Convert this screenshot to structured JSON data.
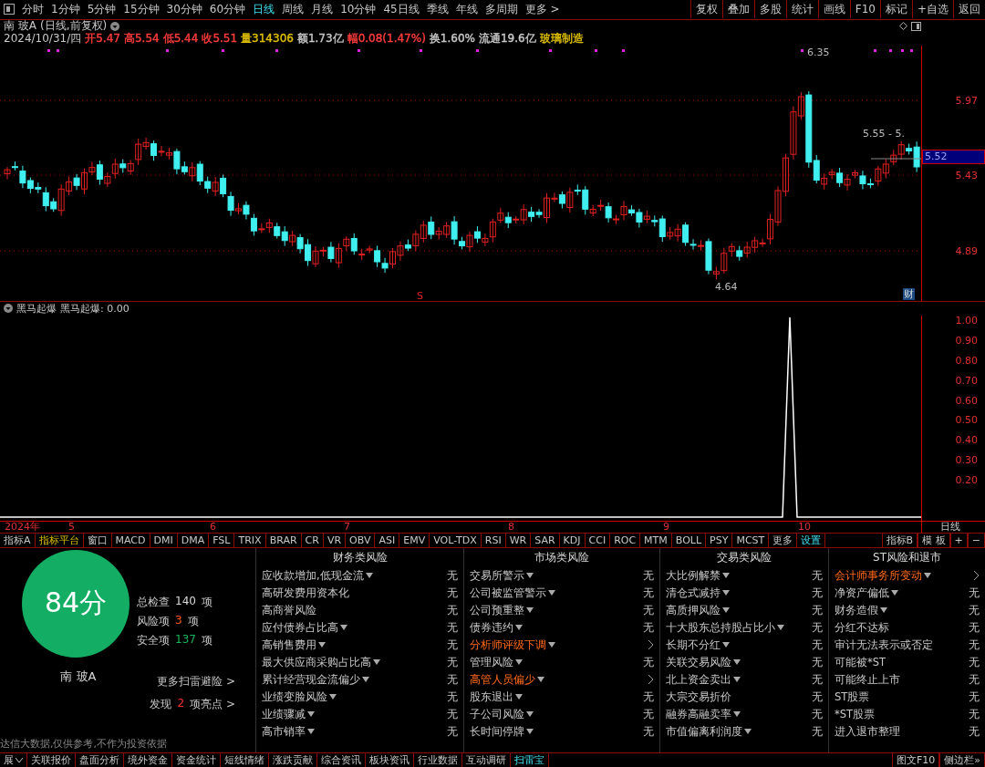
{
  "period_tabs": [
    {
      "label": "分时",
      "selected": false
    },
    {
      "label": "1分钟",
      "selected": false
    },
    {
      "label": "5分钟",
      "selected": false
    },
    {
      "label": "15分钟",
      "selected": false
    },
    {
      "label": "30分钟",
      "selected": false
    },
    {
      "label": "60分钟",
      "selected": false
    },
    {
      "label": "日线",
      "selected": true
    },
    {
      "label": "周线",
      "selected": false
    },
    {
      "label": "月线",
      "selected": false
    },
    {
      "label": "10分钟",
      "selected": false
    },
    {
      "label": "45日线",
      "selected": false
    },
    {
      "label": "季线",
      "selected": false
    },
    {
      "label": "年线",
      "selected": false
    },
    {
      "label": "多周期",
      "selected": false
    },
    {
      "label": "更多 >",
      "selected": false
    }
  ],
  "toolbar_buttons": [
    "复权",
    "叠加",
    "多股",
    "统计",
    "画线",
    "F10",
    "标记",
    "+自选",
    "返回"
  ],
  "stock": {
    "name": "南 玻A",
    "mode": "(日线,前复权)"
  },
  "quote": {
    "date": "2024/10/31/四",
    "items": [
      {
        "text": "开5.47",
        "color": "#ff3c3c"
      },
      {
        "text": "高5.54",
        "color": "#ff3c3c"
      },
      {
        "text": "低5.44",
        "color": "#ff3c3c"
      },
      {
        "text": "收5.51",
        "color": "#ff3c3c"
      },
      {
        "text": "量314306",
        "color": "#e0c000"
      },
      {
        "text": "额1.73亿",
        "color": "#c8c8c8"
      },
      {
        "text": "幅0.08(1.47%)",
        "color": "#ff3c3c"
      },
      {
        "text": "换1.60%",
        "color": "#c8c8c8"
      },
      {
        "text": "流通19.6亿",
        "color": "#c8c8c8"
      },
      {
        "text": "玻璃制造",
        "color": "#e0c000"
      }
    ]
  },
  "main_chart": {
    "high_label": "6.35",
    "low_label": "4.64",
    "last_label": "5.55 - 5.",
    "signal_mark": "S",
    "finance_mark": "财",
    "axis_labels": [
      "5.97",
      "5.43",
      "4.89"
    ],
    "current_price": "5.52"
  },
  "indicator": {
    "name": "黑马起爆",
    "reading": "黑马起爆: 0.00",
    "axis_labels": [
      "1.00",
      "0.90",
      "0.80",
      "0.70",
      "0.60",
      "0.50",
      "0.40",
      "0.30",
      "0.20"
    ]
  },
  "date_axis": {
    "labels": [
      "2024年",
      "5",
      "6",
      "7",
      "8",
      "9",
      "10"
    ],
    "period": "日线"
  },
  "indicator_tabs": [
    {
      "label": "指标A",
      "kind": "tab",
      "selected": false
    },
    {
      "label": "指标平台",
      "kind": "tab",
      "selected": true
    },
    {
      "label": "窗口",
      "kind": "tab",
      "selected": false
    },
    {
      "label": "MACD",
      "kind": "tab",
      "selected": false
    },
    {
      "label": "DMI",
      "kind": "tab",
      "selected": false
    },
    {
      "label": "DMA",
      "kind": "tab",
      "selected": false
    },
    {
      "label": "FSL",
      "kind": "tab",
      "selected": false
    },
    {
      "label": "TRIX",
      "kind": "tab",
      "selected": false
    },
    {
      "label": "BRAR",
      "kind": "tab",
      "selected": false
    },
    {
      "label": "CR",
      "kind": "tab",
      "selected": false
    },
    {
      "label": "VR",
      "kind": "tab",
      "selected": false
    },
    {
      "label": "OBV",
      "kind": "tab",
      "selected": false
    },
    {
      "label": "ASI",
      "kind": "tab",
      "selected": false
    },
    {
      "label": "EMV",
      "kind": "tab",
      "selected": false
    },
    {
      "label": "VOL-TDX",
      "kind": "tab",
      "selected": false
    },
    {
      "label": "RSI",
      "kind": "tab",
      "selected": false
    },
    {
      "label": "WR",
      "kind": "tab",
      "selected": false
    },
    {
      "label": "SAR",
      "kind": "tab",
      "selected": false
    },
    {
      "label": "KDJ",
      "kind": "tab",
      "selected": false
    },
    {
      "label": "CCI",
      "kind": "tab",
      "selected": false
    },
    {
      "label": "ROC",
      "kind": "tab",
      "selected": false
    },
    {
      "label": "MTM",
      "kind": "tab",
      "selected": false
    },
    {
      "label": "BOLL",
      "kind": "tab",
      "selected": false
    },
    {
      "label": "PSY",
      "kind": "tab",
      "selected": false
    },
    {
      "label": "MCST",
      "kind": "tab",
      "selected": false
    },
    {
      "label": "更多",
      "kind": "tab",
      "selected": false
    },
    {
      "label": "设置",
      "kind": "link",
      "selected": false
    }
  ],
  "indicator_tools": [
    "指标B",
    "模 板",
    "+",
    "−"
  ],
  "scan": {
    "score": "84分",
    "name": "南 玻A",
    "stats": [
      {
        "label": "总检查",
        "value": "140",
        "unit": "项",
        "color": "#d8d8d8"
      },
      {
        "label": "风险项",
        "value": "3",
        "unit": "项",
        "color": "#ff5a1f"
      },
      {
        "label": "安全项",
        "value": "137",
        "unit": "项",
        "color": "#1bb55c"
      }
    ],
    "more_link": "更多扫雷避险 >",
    "highlight": {
      "prefix": "发现",
      "count": "2",
      "suffix": "项亮点 >"
    },
    "disclaimer": "达信大数据,仅供参考,不作为投资依据"
  },
  "risk_columns": [
    {
      "title": "财务类风险",
      "items": [
        {
          "label": "应收款增加,低现金流",
          "dropdown": true,
          "flagged": false,
          "result": "无"
        },
        {
          "label": "高研发费用资本化",
          "dropdown": false,
          "flagged": false,
          "result": "无"
        },
        {
          "label": "高商誉风险",
          "dropdown": false,
          "flagged": false,
          "result": "无"
        },
        {
          "label": "应付债券占比高",
          "dropdown": true,
          "flagged": false,
          "result": "无"
        },
        {
          "label": "高销售费用",
          "dropdown": true,
          "flagged": false,
          "result": "无"
        },
        {
          "label": "最大供应商采购占比高",
          "dropdown": true,
          "flagged": false,
          "result": "无"
        },
        {
          "label": "累计经营现金流偏少",
          "dropdown": true,
          "flagged": false,
          "result": "无"
        },
        {
          "label": "业绩变脸风险",
          "dropdown": true,
          "flagged": false,
          "result": "无"
        },
        {
          "label": "业绩骤减",
          "dropdown": true,
          "flagged": false,
          "result": "无"
        },
        {
          "label": "高市销率",
          "dropdown": true,
          "flagged": false,
          "result": "无"
        }
      ]
    },
    {
      "title": "市场类风险",
      "items": [
        {
          "label": "交易所警示",
          "dropdown": true,
          "flagged": false,
          "result": "无"
        },
        {
          "label": "公司被监管警示",
          "dropdown": true,
          "flagged": false,
          "result": "无"
        },
        {
          "label": "公司预重整",
          "dropdown": true,
          "flagged": false,
          "result": "无"
        },
        {
          "label": "债券违约",
          "dropdown": true,
          "flagged": false,
          "result": "无"
        },
        {
          "label": "分析师评级下调",
          "dropdown": true,
          "flagged": true
        },
        {
          "label": "管理风险",
          "dropdown": true,
          "flagged": false,
          "result": "无"
        },
        {
          "label": "高管人员偏少",
          "dropdown": true,
          "flagged": true
        },
        {
          "label": "股东退出",
          "dropdown": true,
          "flagged": false,
          "result": "无"
        },
        {
          "label": "子公司风险",
          "dropdown": true,
          "flagged": false,
          "result": "无"
        },
        {
          "label": "长时间停牌",
          "dropdown": true,
          "flagged": false,
          "result": "无"
        }
      ]
    },
    {
      "title": "交易类风险",
      "items": [
        {
          "label": "大比例解禁",
          "dropdown": true,
          "flagged": false,
          "result": "无"
        },
        {
          "label": "清仓式减持",
          "dropdown": true,
          "flagged": false,
          "result": "无"
        },
        {
          "label": "高质押风险",
          "dropdown": true,
          "flagged": false,
          "result": "无"
        },
        {
          "label": "十大股东总持股占比小",
          "dropdown": true,
          "flagged": false,
          "result": "无"
        },
        {
          "label": "长期不分红",
          "dropdown": true,
          "flagged": false,
          "result": "无"
        },
        {
          "label": "关联交易风险",
          "dropdown": true,
          "flagged": false,
          "result": "无"
        },
        {
          "label": "北上资金卖出",
          "dropdown": true,
          "flagged": false,
          "result": "无"
        },
        {
          "label": "大宗交易折价",
          "dropdown": false,
          "flagged": false,
          "result": "无"
        },
        {
          "label": "融券高融卖率",
          "dropdown": true,
          "flagged": false,
          "result": "无"
        },
        {
          "label": "市值偏离利润度",
          "dropdown": true,
          "flagged": false,
          "result": "无"
        }
      ]
    },
    {
      "title": "ST风险和退市",
      "items": [
        {
          "label": "会计师事务所变动",
          "dropdown": true,
          "flagged": true
        },
        {
          "label": "净资产偏低",
          "dropdown": true,
          "flagged": false,
          "result": "无"
        },
        {
          "label": "财务造假",
          "dropdown": true,
          "flagged": false,
          "result": "无"
        },
        {
          "label": "分红不达标",
          "dropdown": false,
          "flagged": false,
          "result": "无"
        },
        {
          "label": "审计无法表示或否定",
          "dropdown": false,
          "flagged": false,
          "result": "无"
        },
        {
          "label": "可能被*ST",
          "dropdown": false,
          "flagged": false,
          "result": "无"
        },
        {
          "label": "可能终止上市",
          "dropdown": false,
          "flagged": false,
          "result": "无"
        },
        {
          "label": "ST股票",
          "dropdown": false,
          "flagged": false,
          "result": "无"
        },
        {
          "label": "*ST股票",
          "dropdown": false,
          "flagged": false,
          "result": "无"
        },
        {
          "label": "进入退市整理",
          "dropdown": false,
          "flagged": false,
          "result": "无"
        }
      ]
    }
  ],
  "bottom_tabs": [
    {
      "label": "展",
      "selected": false
    },
    {
      "label": "关联报价",
      "selected": false
    },
    {
      "label": "盘面分析",
      "selected": false
    },
    {
      "label": "境外资金",
      "selected": false
    },
    {
      "label": "资金统计",
      "selected": false
    },
    {
      "label": "短线情绪",
      "selected": false
    },
    {
      "label": "涨跌贡献",
      "selected": false
    },
    {
      "label": "综合资讯",
      "selected": false
    },
    {
      "label": "板块资讯",
      "selected": false
    },
    {
      "label": "行业数据",
      "selected": false
    },
    {
      "label": "互动调研",
      "selected": false
    },
    {
      "label": "扫雷宝",
      "selected": true
    }
  ],
  "bottom_right": [
    "图文F10",
    "侧边栏»"
  ]
}
